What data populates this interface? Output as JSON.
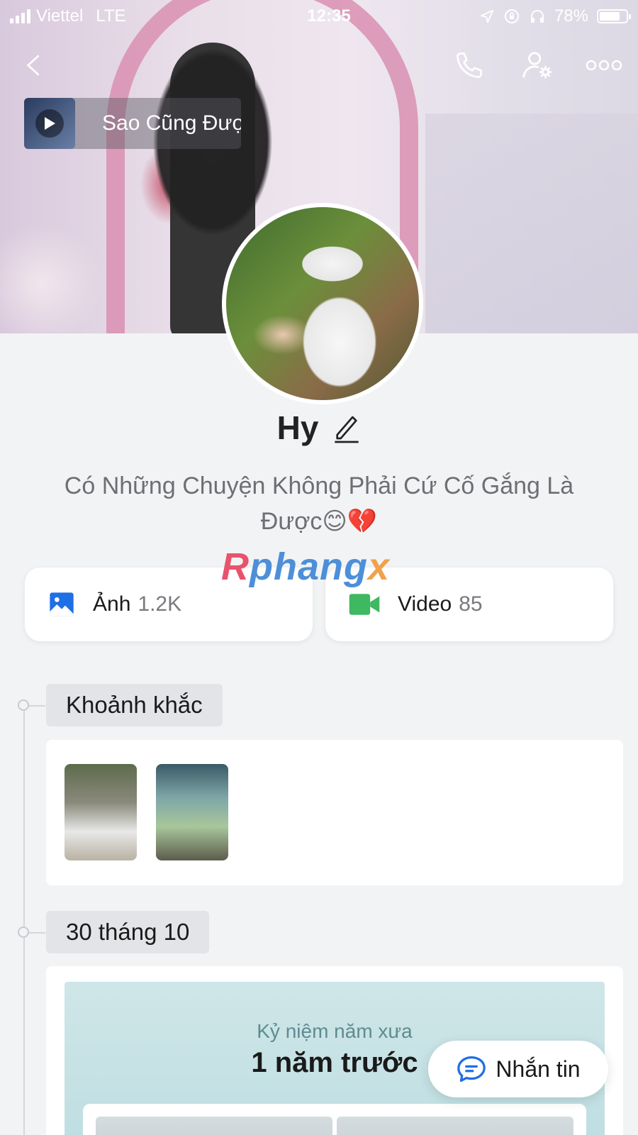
{
  "status_bar": {
    "carrier": "Viettel",
    "network": "LTE",
    "time": "12:35",
    "battery": "78%",
    "battery_level": 0.78
  },
  "header": {
    "back_icon": "chevron-left-icon",
    "call_icon": "phone-icon",
    "settings_icon": "user-settings-icon",
    "more_icon": "more-horizontal-icon"
  },
  "music": {
    "title": "Sao Cũng Được",
    "play_icon": "play-icon"
  },
  "profile": {
    "name": "Hy",
    "edit_icon": "pencil-icon",
    "bio": "Có Những Chuyện Không Phải Cứ Cố Gắng Là Được😊💔"
  },
  "watermark": {
    "part1": "R",
    "part2": "phang",
    "part3": "x"
  },
  "stats": {
    "photos_label": "Ảnh",
    "photos_count": "1.2K",
    "videos_label": "Video",
    "videos_count": "85"
  },
  "sections": {
    "moments_label": "Khoảnh khắc",
    "date_label": "30 tháng 10"
  },
  "memory": {
    "subtitle": "Kỷ niệm năm xưa",
    "title": "1 năm trước"
  },
  "message_button": {
    "label": "Nhắn tin",
    "icon": "chat-bubble-icon"
  },
  "colors": {
    "accent_blue": "#1f6fe5",
    "video_green": "#3fb862",
    "background": "#f2f3f5"
  }
}
